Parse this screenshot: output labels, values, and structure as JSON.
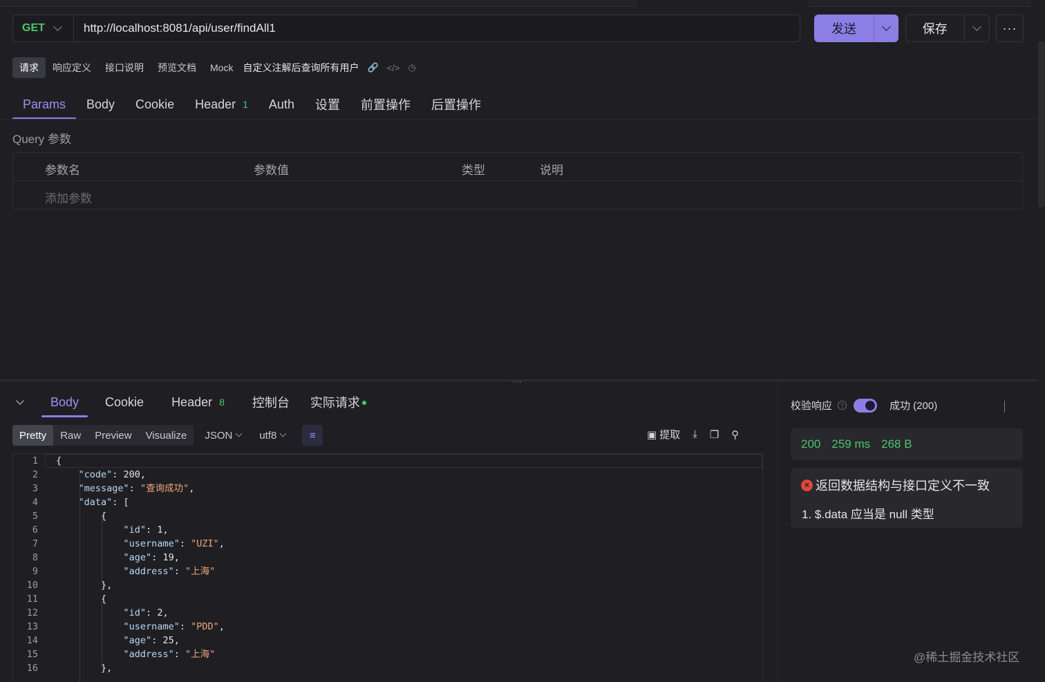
{
  "request": {
    "method": "GET",
    "url": "http://localhost:8081/api/user/findAll1",
    "send_label": "发送",
    "save_label": "保存",
    "more_label": "···"
  },
  "subtabs": {
    "items": [
      "请求",
      "响应定义",
      "接口说明",
      "预览文档",
      "Mock"
    ],
    "title": "自定义注解后查询所有用户"
  },
  "request_tabs": {
    "params": "Params",
    "body": "Body",
    "cookie": "Cookie",
    "header": "Header",
    "header_count": "1",
    "auth": "Auth",
    "settings": "设置",
    "pre": "前置操作",
    "post": "后置操作"
  },
  "query": {
    "label": "Query 参数",
    "columns": [
      "参数名",
      "参数值",
      "类型",
      "说明"
    ],
    "add_placeholder": "添加参数"
  },
  "response_tabs": {
    "body": "Body",
    "cookie": "Cookie",
    "header": "Header",
    "header_count": "8",
    "console": "控制台",
    "actual": "实际请求"
  },
  "format_bar": {
    "modes": [
      "Pretty",
      "Raw",
      "Preview",
      "Visualize"
    ],
    "format": "JSON",
    "encoding": "utf8",
    "extract": "提取"
  },
  "code_lines": [
    {
      "n": "1",
      "t": "{"
    },
    {
      "n": "2",
      "t": "    \"code\": 200,"
    },
    {
      "n": "3",
      "t": "    \"message\": \"查询成功\","
    },
    {
      "n": "4",
      "t": "    \"data\": ["
    },
    {
      "n": "5",
      "t": "        {"
    },
    {
      "n": "6",
      "t": "            \"id\": 1,"
    },
    {
      "n": "7",
      "t": "            \"username\": \"UZI\","
    },
    {
      "n": "8",
      "t": "            \"age\": 19,"
    },
    {
      "n": "9",
      "t": "            \"address\": \"上海\""
    },
    {
      "n": "10",
      "t": "        },"
    },
    {
      "n": "11",
      "t": "        {"
    },
    {
      "n": "12",
      "t": "            \"id\": 2,"
    },
    {
      "n": "13",
      "t": "            \"username\": \"PDD\","
    },
    {
      "n": "14",
      "t": "            \"age\": 25,"
    },
    {
      "n": "15",
      "t": "            \"address\": \"上海\""
    },
    {
      "n": "16",
      "t": "        },"
    }
  ],
  "validation": {
    "label": "校验响应",
    "enabled": true,
    "result": "成功 (200)"
  },
  "status": {
    "code": "200",
    "time": "259 ms",
    "size": "268 B"
  },
  "error": {
    "title": "返回数据结构与接口定义不一致",
    "detail": "1. $.data 应当是 null 类型"
  },
  "watermark": "@稀土掘金技术社区",
  "colors": {
    "accent": "#8d7ee6",
    "success": "#4cc66b",
    "error": "#e0453c"
  }
}
